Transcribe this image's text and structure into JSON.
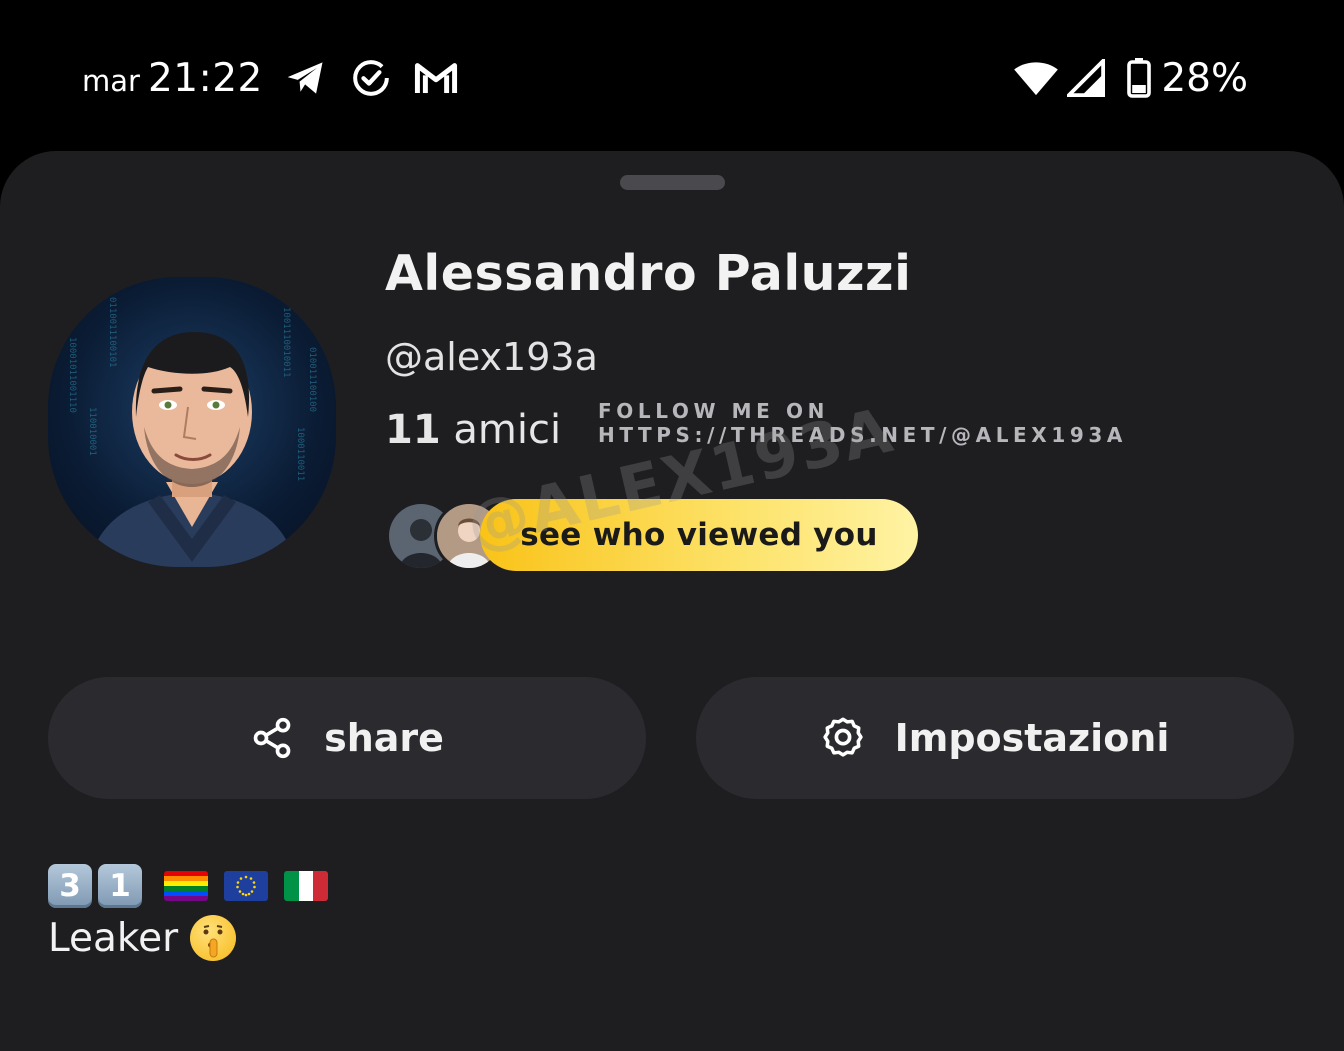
{
  "status_bar": {
    "day": "mar",
    "time": "21:22",
    "battery": "28%",
    "icons": [
      "telegram-icon",
      "check-circle-icon",
      "gmail-icon",
      "wifi-icon",
      "signal-icon",
      "battery-icon"
    ]
  },
  "profile": {
    "name": "Alessandro Paluzzi",
    "username": "@alex193a",
    "friends_count": "11",
    "friends_label": "amici",
    "viewers_button": "see who viewed you"
  },
  "watermark": {
    "line": "FOLLOW ME ON HTTPS://THREADS.NET/@ALEX193A",
    "diagonal": "@ALEX193A"
  },
  "actions": {
    "share_label": "share",
    "settings_label": "Impostazioni"
  },
  "bio": {
    "keycaps": [
      "3",
      "1"
    ],
    "flags": [
      "rainbow-flag",
      "eu-flag",
      "italy-flag"
    ],
    "text": "Leaker"
  },
  "colors": {
    "background": "#000000",
    "sheet": "#1e1e21",
    "button": "#2b2b2f",
    "pill_gradient_start": "#f9c318",
    "pill_gradient_end": "#fff3a4"
  }
}
